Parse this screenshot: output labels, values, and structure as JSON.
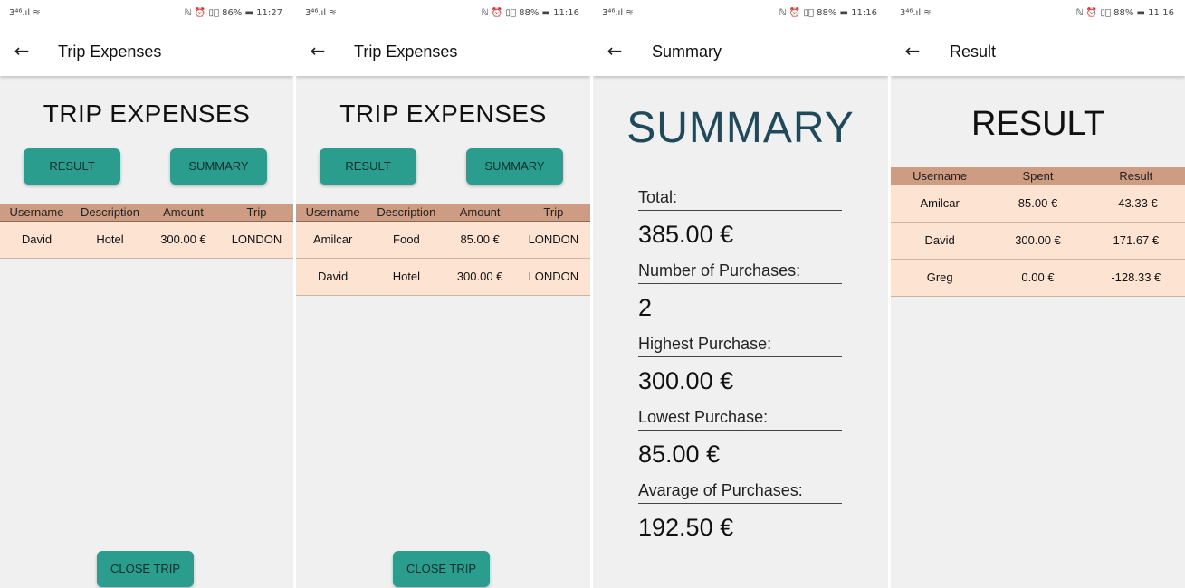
{
  "screens": [
    {
      "status": {
        "left": "3⁴⁶.ıl ≋",
        "right": "ℕ ⏰ ▯⃠ 86% ▬ 11:27"
      },
      "appbar_title": "Trip Expenses",
      "heading": "TRIP EXPENSES",
      "buttons": {
        "result": "RESULT",
        "summary": "SUMMARY",
        "close": "CLOSE TRIP"
      },
      "table": {
        "headers": [
          "Username",
          "Description",
          "Amount",
          "Trip"
        ],
        "rows": [
          [
            "David",
            "Hotel",
            "300.00 €",
            "LONDON"
          ]
        ]
      }
    },
    {
      "status": {
        "left": "3⁴⁶.ıl ≋",
        "right": "ℕ ⏰ ▯⃠ 88% ▬ 11:16"
      },
      "appbar_title": "Trip Expenses",
      "heading": "TRIP EXPENSES",
      "buttons": {
        "result": "RESULT",
        "summary": "SUMMARY",
        "close": "CLOSE TRIP"
      },
      "table": {
        "headers": [
          "Username",
          "Description",
          "Amount",
          "Trip"
        ],
        "rows": [
          [
            "Amilcar",
            "Food",
            "85.00 €",
            "LONDON"
          ],
          [
            "David",
            "Hotel",
            "300.00 €",
            "LONDON"
          ]
        ]
      }
    },
    {
      "status": {
        "left": "3⁴⁶.ıl ≋",
        "right": "ℕ ⏰ ▯⃠ 88% ▬ 11:16"
      },
      "appbar_title": "Summary",
      "heading": "SUMMARY",
      "items": [
        {
          "label": "Total:",
          "value": "385.00 €"
        },
        {
          "label": "Number of Purchases:",
          "value": "2"
        },
        {
          "label": "Highest Purchase:",
          "value": "300.00 €"
        },
        {
          "label": "Lowest Purchase:",
          "value": "85.00 €"
        },
        {
          "label": "Avarage of Purchases:",
          "value": "192.50 €"
        }
      ]
    },
    {
      "status": {
        "left": "3⁴⁶.ıl ≋",
        "right": "ℕ ⏰ ▯⃠ 88% ▬ 11:16"
      },
      "appbar_title": "Result",
      "heading": "RESULT",
      "table": {
        "headers": [
          "Username",
          "Spent",
          "Result"
        ],
        "rows": [
          [
            "Amilcar",
            "85.00 €",
            "-43.33 €"
          ],
          [
            "David",
            "300.00 €",
            "171.67 €"
          ],
          [
            "Greg",
            "0.00 €",
            "-128.33 €"
          ]
        ]
      }
    }
  ],
  "icons": {
    "back": "arrow-left-icon"
  },
  "colors": {
    "button": "#2a9d8f",
    "table_header": "#cd9c82",
    "table_row": "#fde3d2",
    "summary_heading": "#1f4a5c"
  }
}
